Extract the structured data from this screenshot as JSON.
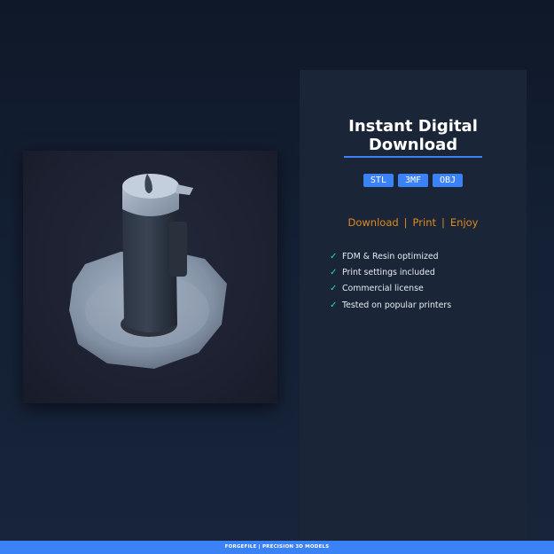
{
  "product": {
    "image_alt": "3D printed tower model"
  },
  "panel": {
    "title_line1": "Instant Digital",
    "title_line2": "Download",
    "badges": [
      "STL",
      "3MF",
      "OBJ"
    ],
    "tagline": [
      "Download",
      "Print",
      "Enjoy"
    ],
    "tagline_separator": "|",
    "features": [
      "FDM & Resin optimized",
      "Print settings included",
      "Commercial license",
      "Tested on popular printers"
    ],
    "check_icon": "check-icon"
  },
  "footer": {
    "text": "FORGEFILE | PRECISION 3D MODELS"
  },
  "colors": {
    "accent": "#3b82f6",
    "tagline": "#e08a1e",
    "check": "#2dd4bf",
    "panel_bg": "#1b2538",
    "page_bg": "#142035"
  }
}
